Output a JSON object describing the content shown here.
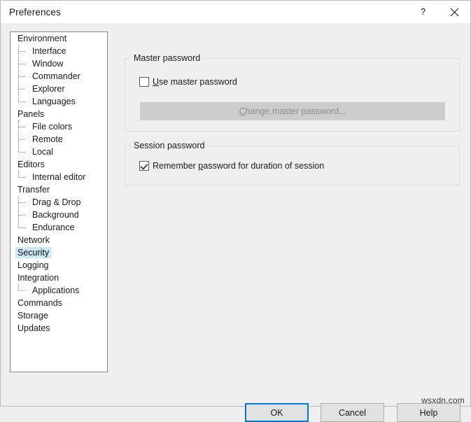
{
  "window": {
    "title": "Preferences",
    "help_icon": "question-mark-icon",
    "close_icon": "close-icon"
  },
  "sidebar": {
    "selected": "Security",
    "items": [
      {
        "label": "Environment",
        "level": 0,
        "last": false
      },
      {
        "label": "Interface",
        "level": 1,
        "last": false
      },
      {
        "label": "Window",
        "level": 1,
        "last": false
      },
      {
        "label": "Commander",
        "level": 1,
        "last": false
      },
      {
        "label": "Explorer",
        "level": 1,
        "last": false
      },
      {
        "label": "Languages",
        "level": 1,
        "last": true
      },
      {
        "label": "Panels",
        "level": 0,
        "last": false
      },
      {
        "label": "File colors",
        "level": 1,
        "last": false
      },
      {
        "label": "Remote",
        "level": 1,
        "last": false
      },
      {
        "label": "Local",
        "level": 1,
        "last": true
      },
      {
        "label": "Editors",
        "level": 0,
        "last": false
      },
      {
        "label": "Internal editor",
        "level": 1,
        "last": true
      },
      {
        "label": "Transfer",
        "level": 0,
        "last": false
      },
      {
        "label": "Drag & Drop",
        "level": 1,
        "last": false
      },
      {
        "label": "Background",
        "level": 1,
        "last": false
      },
      {
        "label": "Endurance",
        "level": 1,
        "last": true
      },
      {
        "label": "Network",
        "level": 0,
        "last": false
      },
      {
        "label": "Security",
        "level": 0,
        "last": false
      },
      {
        "label": "Logging",
        "level": 0,
        "last": false
      },
      {
        "label": "Integration",
        "level": 0,
        "last": false
      },
      {
        "label": "Applications",
        "level": 1,
        "last": true
      },
      {
        "label": "Commands",
        "level": 0,
        "last": false
      },
      {
        "label": "Storage",
        "level": 0,
        "last": false
      },
      {
        "label": "Updates",
        "level": 0,
        "last": false
      }
    ]
  },
  "master_password": {
    "group_title": "Master password",
    "use_master": {
      "label_before": "",
      "accel": "U",
      "label_after": "se master password",
      "checked": false
    },
    "change_button": {
      "label_before": "",
      "accel": "C",
      "label_after": "hange master password...",
      "enabled": false
    }
  },
  "session_password": {
    "group_title": "Session password",
    "remember": {
      "label_before": "Remember ",
      "accel": "p",
      "label_after": "assword for duration of session",
      "checked": true
    }
  },
  "footer": {
    "ok_label": "OK",
    "cancel_label": "Cancel",
    "help_label": "Help"
  },
  "watermark": "wsxdn.com",
  "colors": {
    "window_bg": "#efefef",
    "titlebar_bg": "#ffffff",
    "tree_bg": "#ffffff",
    "selection": "#cce8f7",
    "accent_focus": "#0078d7",
    "disabled_button": "#cccccc",
    "disabled_text": "#8d8d8d"
  }
}
